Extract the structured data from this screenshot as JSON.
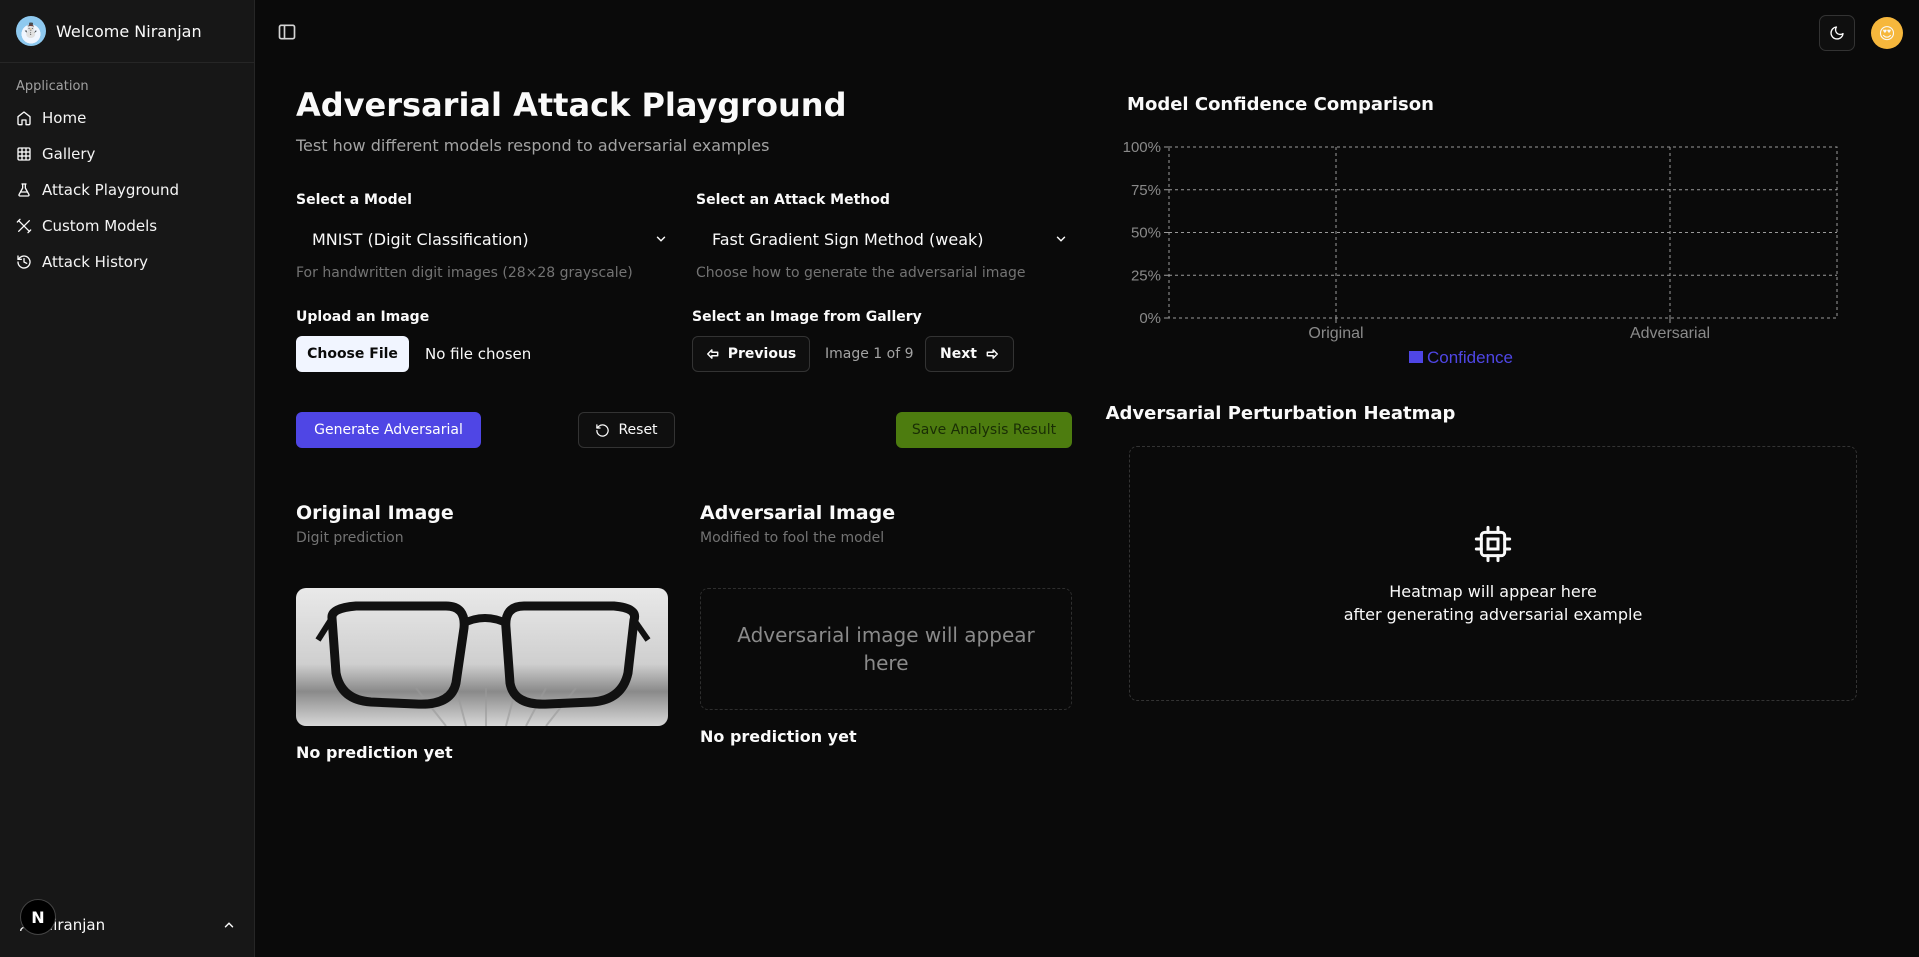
{
  "sidebar": {
    "welcome": "Welcome Niranjan",
    "group_label": "Application",
    "items": [
      {
        "label": "Home",
        "icon": "home-icon"
      },
      {
        "label": "Gallery",
        "icon": "grid-icon"
      },
      {
        "label": "Attack Playground",
        "icon": "flask-icon"
      },
      {
        "label": "Custom Models",
        "icon": "tools-icon"
      },
      {
        "label": "Attack History",
        "icon": "history-icon"
      }
    ],
    "footer_user": "Niranjan",
    "badge": "N"
  },
  "header": {
    "title": "Adversarial Attack Playground",
    "subtitle": "Test how different models respond to adversarial examples"
  },
  "model": {
    "label": "Select a Model",
    "value": "MNIST (Digit Classification)",
    "hint": "For handwritten digit images (28×28 grayscale)"
  },
  "attack": {
    "label": "Select an Attack Method",
    "value": "Fast Gradient Sign Method (weak)",
    "hint": "Choose how to generate the adversarial image"
  },
  "upload": {
    "label": "Upload an Image",
    "button": "Choose File",
    "status": "No file chosen"
  },
  "gallery": {
    "label": "Select an Image from Gallery",
    "prev": "Previous",
    "indicator": "Image 1 of 9",
    "next": "Next"
  },
  "actions": {
    "generate": "Generate Adversarial",
    "reset": "Reset",
    "save": "Save Analysis Result"
  },
  "original": {
    "title": "Original Image",
    "subtitle": "Digit prediction",
    "prediction": "No prediction yet"
  },
  "adversarial": {
    "title": "Adversarial Image",
    "subtitle": "Modified to fool the model",
    "placeholder": "Adversarial image will appear here",
    "prediction": "No prediction yet"
  },
  "chart_title": "Model Confidence Comparison",
  "chart_data": {
    "type": "bar",
    "title": "Model Confidence Comparison",
    "categories": [
      "Original",
      "Adversarial"
    ],
    "series": [
      {
        "name": "Confidence",
        "values": [
          0,
          0
        ],
        "color": "#4f46e5"
      }
    ],
    "yticks": [
      "0%",
      "25%",
      "50%",
      "75%",
      "100%"
    ],
    "ylim": [
      0,
      100
    ],
    "grid": true,
    "legend": "bottom"
  },
  "heatmap": {
    "title": "Adversarial Perturbation Heatmap",
    "line1": "Heatmap will appear here",
    "line2": "after generating adversarial example",
    "icon": "cpu-icon"
  },
  "colors": {
    "primary": "#4f46e5",
    "save": "#4d7c0f",
    "background": "#0a0a0a"
  }
}
